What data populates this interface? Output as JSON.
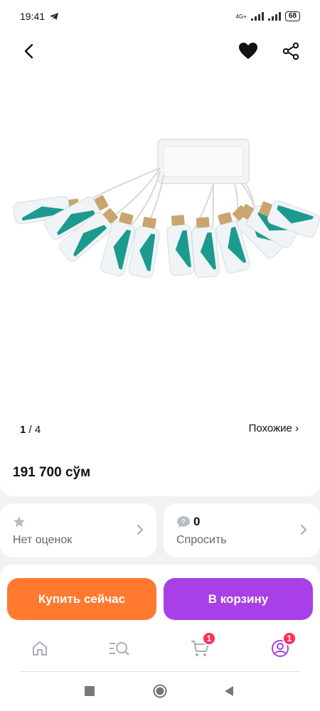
{
  "status_bar": {
    "time": "19:41",
    "network": "4G+",
    "battery": "68"
  },
  "header": {
    "back_icon": "chevron-left-icon",
    "favorite_icon": "heart-icon",
    "share_icon": "share-icon"
  },
  "gallery": {
    "current_page": "1",
    "page_separator": "/ 4",
    "similar_label": "Похожие ›"
  },
  "product": {
    "price": "191 700 сўм"
  },
  "rating": {
    "label": "Нет оценок",
    "icon": "star-icon"
  },
  "questions": {
    "count": "0",
    "label": "Спросить",
    "icon": "question-bubble-icon"
  },
  "actions": {
    "buy_now": "Купить сейчас",
    "add_to_cart": "В корзину"
  },
  "tabbar": {
    "cart_badge": "1",
    "profile_badge": "1"
  },
  "colors": {
    "buy_now": "#ff7a2f",
    "add_to_cart": "#a93fe6",
    "badge": "#ff2d55"
  }
}
